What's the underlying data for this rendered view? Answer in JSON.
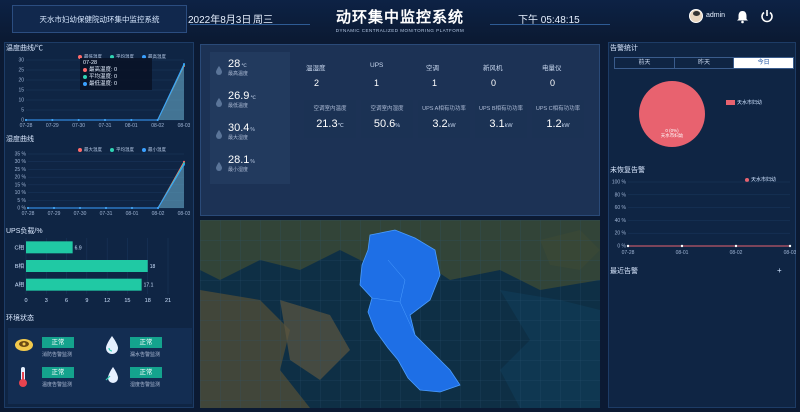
{
  "header": {
    "org": "天水市妇幼保健院动环集中监控系统",
    "date": "2022年8月3日",
    "weekday": "周三",
    "title": "动环集中监控系统",
    "subtitle": "DYNAMIC CENTRALIZED MONITORING PLATFORM",
    "time": "下午 05:48:15",
    "user": "admin"
  },
  "temp_chart": {
    "title": "温度曲线/℃",
    "legend": [
      "最低温度",
      "平均温度",
      "最高温度"
    ],
    "tooltip": {
      "date": "07-28",
      "rows": [
        "最高温度: 0",
        "平均温度: 0",
        "最低温度: 0"
      ]
    }
  },
  "hum_chart": {
    "title": "湿度曲线",
    "legend": [
      "最大温度",
      "平均温度",
      "最小温度"
    ]
  },
  "ups_chart": {
    "title": "UPS负载/%"
  },
  "env": {
    "title": "环境状态",
    "items": [
      {
        "status": "正常",
        "label": "消防告警监测"
      },
      {
        "status": "正常",
        "label": "漏水告警监测"
      },
      {
        "status": "正常",
        "label": "温度告警监测"
      },
      {
        "status": "正常",
        "label": "湿度告警监测"
      }
    ]
  },
  "stats": {
    "temps": [
      {
        "value": "28",
        "unit": "℃",
        "label": "最高温度"
      },
      {
        "value": "26.9",
        "unit": "℃",
        "label": "最低温度"
      },
      {
        "value": "30.4",
        "unit": "%",
        "label": "最大湿度"
      },
      {
        "value": "28.1",
        "unit": "%",
        "label": "最小湿度"
      }
    ],
    "counts": [
      {
        "label": "温湿度",
        "value": "2"
      },
      {
        "label": "UPS",
        "value": "1"
      },
      {
        "label": "空调",
        "value": "1"
      },
      {
        "label": "新风机",
        "value": "0"
      },
      {
        "label": "电量仪",
        "value": "0"
      }
    ],
    "metrics": [
      {
        "label": "空调室内温度",
        "value": "21.3",
        "unit": "℃"
      },
      {
        "label": "空调室内湿度",
        "value": "50.6",
        "unit": "%"
      },
      {
        "label": "UPS A相有功功率",
        "value": "3.2",
        "unit": "kW"
      },
      {
        "label": "UPS B相有功功率",
        "value": "3.1",
        "unit": "kW"
      },
      {
        "label": "UPS C相有功功率",
        "value": "1.2",
        "unit": "kW"
      }
    ]
  },
  "alarm": {
    "title": "告警统计",
    "tabs": [
      "前天",
      "昨天",
      "今日"
    ],
    "active_tab": 2,
    "pie_legend": "天水市妇幼",
    "pie_center": "0 (0%)",
    "pie_center2": "天水市妇幼",
    "unresolved_title": "未恢复告警",
    "unresolved_legend": "天水市妇幼",
    "recent_title": "最近告警",
    "plus": "+"
  },
  "chart_data": [
    {
      "type": "area",
      "x": [
        "07-28",
        "07-29",
        "07-30",
        "07-31",
        "08-01",
        "08-02",
        "08-03"
      ],
      "ylim": [
        0,
        30
      ],
      "yticks": [
        0,
        5,
        10,
        15,
        20,
        25,
        30
      ],
      "series": [
        {
          "name": "最低温度",
          "values": [
            0,
            0,
            0,
            0,
            0,
            0,
            27
          ],
          "color": "#ff6b6b"
        },
        {
          "name": "平均温度",
          "values": [
            0,
            0,
            0,
            0,
            0,
            0,
            27.5
          ],
          "color": "#2fd3b3"
        },
        {
          "name": "最高温度",
          "values": [
            0,
            0,
            0,
            0,
            0,
            0,
            28
          ],
          "color": "#3aa0ff"
        }
      ]
    },
    {
      "type": "area",
      "x": [
        "07-28",
        "07-29",
        "07-30",
        "07-31",
        "08-01",
        "08-02",
        "08-03"
      ],
      "ylim": [
        0,
        35
      ],
      "yticks": [
        "0 %",
        "5 %",
        "10 %",
        "15 %",
        "20 %",
        "25 %",
        "30 %",
        "35 %"
      ],
      "series": [
        {
          "name": "最大温度",
          "values": [
            0,
            0,
            0,
            0,
            0,
            0,
            30
          ],
          "color": "#ff6b6b"
        },
        {
          "name": "平均温度",
          "values": [
            0,
            0,
            0,
            0,
            0,
            0,
            29
          ],
          "color": "#2fd3b3"
        },
        {
          "name": "最小温度",
          "values": [
            0,
            0,
            0,
            0,
            0,
            0,
            28
          ],
          "color": "#3aa0ff"
        }
      ]
    },
    {
      "type": "bar",
      "orientation": "horizontal",
      "categories": [
        "C相",
        "B相",
        "A相"
      ],
      "values": [
        6.9,
        18,
        17.1
      ],
      "xlim": [
        0,
        21
      ],
      "xticks": [
        0,
        3,
        6,
        9,
        12,
        15,
        18,
        21
      ],
      "color": "#20c9a4"
    },
    {
      "type": "pie",
      "labels": [
        "天水市妇幼"
      ],
      "values": [
        0
      ],
      "color": "#e8626f"
    },
    {
      "type": "line",
      "x": [
        "07-28",
        "08-01",
        "08-02",
        "08-03"
      ],
      "ylim": [
        0,
        100
      ],
      "yticks": [
        "0 %",
        "20 %",
        "40 %",
        "60 %",
        "80 %",
        "100 %"
      ],
      "series": [
        {
          "name": "天水市妇幼",
          "values": [
            0,
            0,
            0,
            0
          ],
          "color": "#e8626f"
        }
      ]
    }
  ]
}
